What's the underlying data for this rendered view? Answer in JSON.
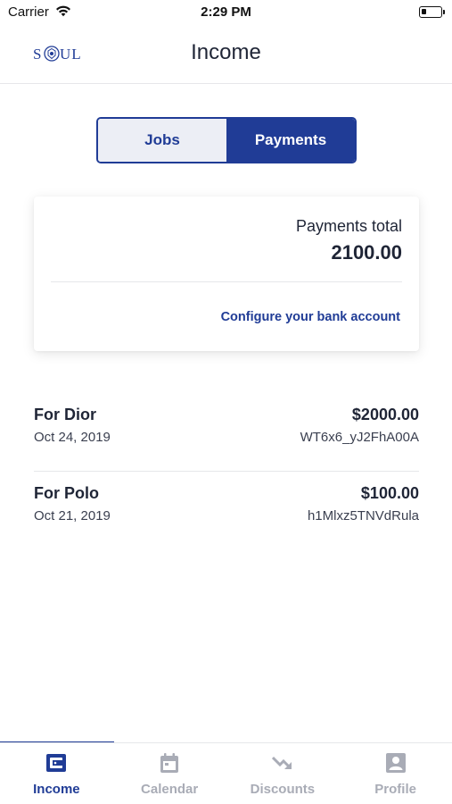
{
  "status_bar": {
    "carrier": "Carrier",
    "time": "2:29 PM",
    "battery_level": 0.25
  },
  "header": {
    "logo_text": "SOUL",
    "title": "Income"
  },
  "segments": [
    {
      "label": "Jobs",
      "active": false
    },
    {
      "label": "Payments",
      "active": true
    }
  ],
  "summary": {
    "total_label": "Payments total",
    "total_value": "2100.00",
    "bank_link": "Configure your bank account"
  },
  "payments": [
    {
      "title": "For Dior",
      "date": "Oct 24, 2019",
      "amount": "$2000.00",
      "reference": "WT6x6_yJ2FhA00A"
    },
    {
      "title": "For Polo",
      "date": "Oct 21, 2019",
      "amount": "$100.00",
      "reference": "h1Mlxz5TNVdRula"
    }
  ],
  "tabs": [
    {
      "label": "Income",
      "icon": "wallet-icon",
      "active": true
    },
    {
      "label": "Calendar",
      "icon": "calendar-icon",
      "active": false
    },
    {
      "label": "Discounts",
      "icon": "trend-down-icon",
      "active": false
    },
    {
      "label": "Profile",
      "icon": "profile-icon",
      "active": false
    }
  ],
  "colors": {
    "accent": "#203c96",
    "text": "#1f2536",
    "inactive_tab": "#a9acb6",
    "segment_inactive_bg": "#eceef5"
  }
}
